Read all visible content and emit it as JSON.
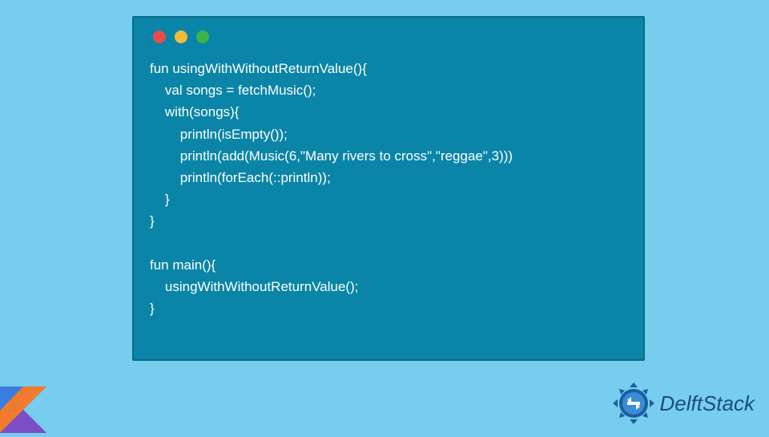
{
  "code": {
    "lines": [
      "fun usingWithWithoutReturnValue(){",
      "    val songs = fetchMusic();",
      "    with(songs){",
      "        println(isEmpty());",
      "        println(add(Music(6,\"Many rivers to cross\",\"reggae\",3)))",
      "        println(forEach(::println));",
      "    }",
      "}",
      "",
      "fun main(){",
      "    usingWithWithoutReturnValue();",
      "}"
    ]
  },
  "brand": {
    "name": "DelftStack"
  },
  "colors": {
    "panel_bg": "#0a85a7",
    "page_bg": "#77cdee",
    "brand_text": "#1c4d7a"
  }
}
